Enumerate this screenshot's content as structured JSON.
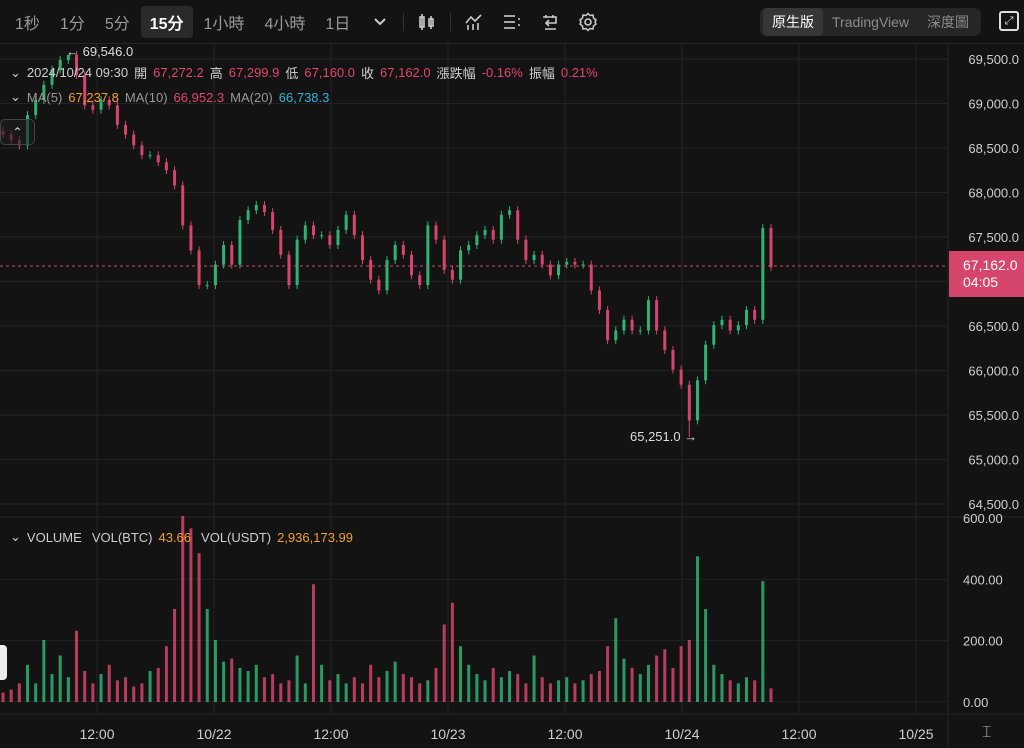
{
  "toolbar": {
    "timeframes": [
      "1秒",
      "1分",
      "5分",
      "15分",
      "1小時",
      "4小時",
      "1日"
    ],
    "active_timeframe": "15分",
    "icons": [
      "chevron-down-icon",
      "candlestick-icon",
      "indicator-icon",
      "list-icon",
      "replay-icon",
      "gear-icon"
    ],
    "views": [
      "原生版",
      "TradingView",
      "深度圖"
    ],
    "active_view": "原生版"
  },
  "ohlc_legend": {
    "datetime": "2024/10/24 09:30",
    "open_label": "開",
    "open": "67,272.2",
    "high_label": "高",
    "high": "67,299.9",
    "low_label": "低",
    "low": "67,160.0",
    "close_label": "收",
    "close": "67,162.0",
    "change_label": "漲跌幅",
    "change": "-0.16%",
    "amp_label": "振幅",
    "amp": "0.21%"
  },
  "ma_legend": {
    "ma5_label": "MA(5)",
    "ma5": "67,237.8",
    "ma10_label": "MA(10)",
    "ma10": "66,952.3",
    "ma20_label": "MA(20)",
    "ma20": "66,738.3"
  },
  "volume_legend": {
    "title": "VOLUME",
    "btc_label": "VOL(BTC)",
    "btc": "43.66",
    "usdt_label": "VOL(USDT)",
    "usdt": "2,936,173.99"
  },
  "last_price": {
    "price": "67,162.0",
    "countdown": "04:05"
  },
  "colors": {
    "up": "#2fb374",
    "down": "#d6456b",
    "bg": "#131313",
    "grid": "#232323"
  },
  "chart_data": {
    "type": "candlestick",
    "interval": "15m",
    "price_axis": {
      "ticks": [
        "69,500.0",
        "69,000.0",
        "68,500.0",
        "68,000.0",
        "67,500.0",
        "67,000.0",
        "66,500.0",
        "66,000.0",
        "65,500.0",
        "65,000.0",
        "64,500.0"
      ],
      "ylim": [
        64500,
        69500
      ]
    },
    "volume_axis": {
      "ticks": [
        "600.00",
        "400.00",
        "200.00",
        "0.00"
      ],
      "ylim": [
        0,
        600
      ]
    },
    "time_ticks": [
      "12:00",
      "10/22",
      "12:00",
      "10/23",
      "12:00",
      "10/24",
      "12:00",
      "10/25"
    ],
    "max_marker": {
      "label": "← 69,546.0",
      "value": 69546
    },
    "min_marker": {
      "label": "65,251.0 →",
      "value": 65251
    },
    "closes": [
      68650,
      68590,
      68530,
      68870,
      69040,
      69210,
      69380,
      69490,
      69545,
      69320,
      68980,
      68930,
      69040,
      68980,
      68760,
      68650,
      68530,
      68420,
      68420,
      68340,
      68250,
      68080,
      67630,
      67350,
      66960,
      66960,
      67190,
      67410,
      67190,
      67690,
      67800,
      67860,
      67780,
      67580,
      67300,
      66960,
      67470,
      67630,
      67520,
      67520,
      67410,
      67580,
      67750,
      67520,
      67240,
      67020,
      66900,
      67240,
      67410,
      67300,
      67070,
      66960,
      67630,
      67470,
      67130,
      67020,
      67350,
      67410,
      67520,
      67580,
      67470,
      67750,
      67800,
      67470,
      67240,
      67300,
      67190,
      67070,
      67190,
      67220,
      67190,
      67190,
      66900,
      66680,
      66340,
      66450,
      66570,
      66450,
      66450,
      66790,
      66450,
      66230,
      66010,
      65840,
      65440,
      65890,
      66290,
      66510,
      66570,
      66450,
      66510,
      66680,
      66570,
      67600,
      67162
    ],
    "volumes": [
      30,
      40,
      60,
      120,
      60,
      200,
      90,
      150,
      80,
      230,
      100,
      60,
      90,
      120,
      70,
      80,
      50,
      60,
      100,
      110,
      180,
      300,
      600,
      560,
      480,
      300,
      200,
      130,
      140,
      110,
      100,
      120,
      80,
      90,
      60,
      70,
      150,
      60,
      380,
      120,
      70,
      90,
      60,
      80,
      60,
      120,
      80,
      100,
      130,
      90,
      80,
      60,
      70,
      110,
      250,
      320,
      180,
      120,
      90,
      70,
      110,
      80,
      100,
      90,
      60,
      150,
      80,
      60,
      70,
      80,
      60,
      70,
      90,
      100,
      180,
      270,
      140,
      110,
      90,
      120,
      150,
      170,
      110,
      180,
      200,
      470,
      300,
      120,
      90,
      70,
      60,
      80,
      70,
      390,
      44
    ]
  }
}
